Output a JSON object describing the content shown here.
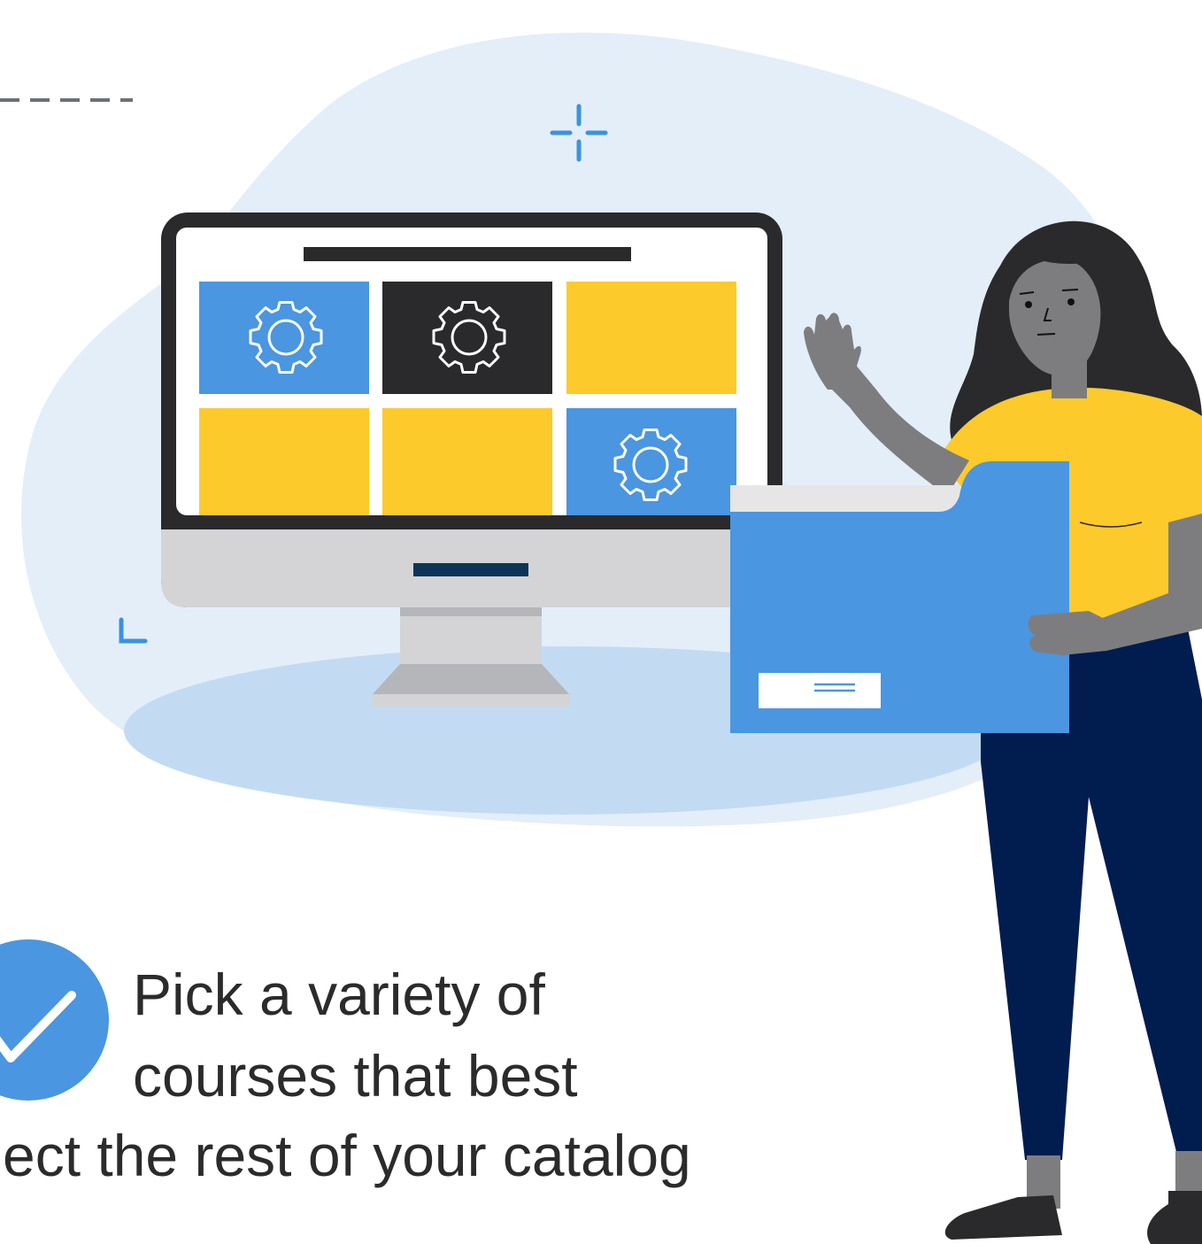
{
  "caption": {
    "line1": "Pick a variety of",
    "line2": "courses that best",
    "line3": "flect the rest of your catalog"
  },
  "colors": {
    "blob": "#e3eef9",
    "floor": "#c2dbf3",
    "accent_blue": "#4a96e0",
    "yellow": "#fdca2b",
    "dark": "#2a2a2c",
    "navy": "#011c4e",
    "skin": "#7d7d7f",
    "monitor_base": "#d4d4d6",
    "text": "#2b2b2b"
  },
  "icons": {
    "gear": "gear-icon",
    "check": "check-icon",
    "sparkle": "sparkle-icon",
    "corner": "corner-mark-icon"
  }
}
